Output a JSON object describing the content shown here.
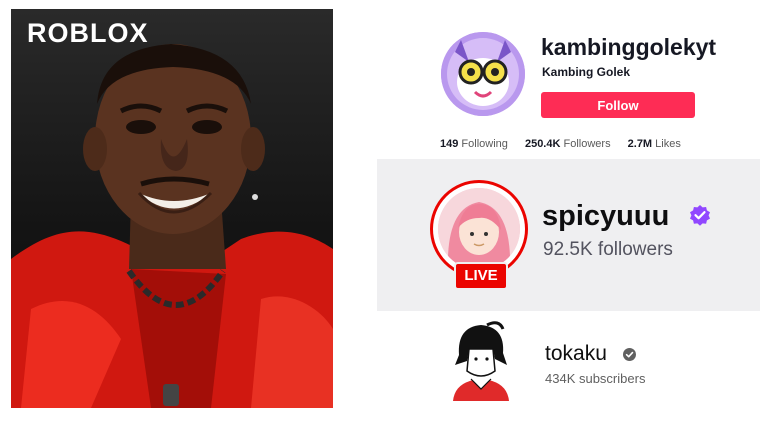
{
  "photo": {
    "logo_text": "ROBLOX"
  },
  "tiktok": {
    "username": "kambinggolekyt",
    "nickname": "Kambing Golek",
    "follow_label": "Follow",
    "stats": [
      {
        "value": "149",
        "label": "Following"
      },
      {
        "value": "250.4K",
        "label": "Followers"
      },
      {
        "value": "2.7M",
        "label": "Likes"
      }
    ],
    "accent": "#fe2c55"
  },
  "twitch": {
    "channel": "spicyuuu",
    "followers": "92.5K followers",
    "live_label": "LIVE",
    "live_color": "#eb0400",
    "badge_icon": "verified-badge-icon",
    "badge_color": "#9147ff"
  },
  "youtube": {
    "channel": "tokaku",
    "subscribers": "434K subscribers",
    "verified_icon": "verified-check-icon"
  }
}
